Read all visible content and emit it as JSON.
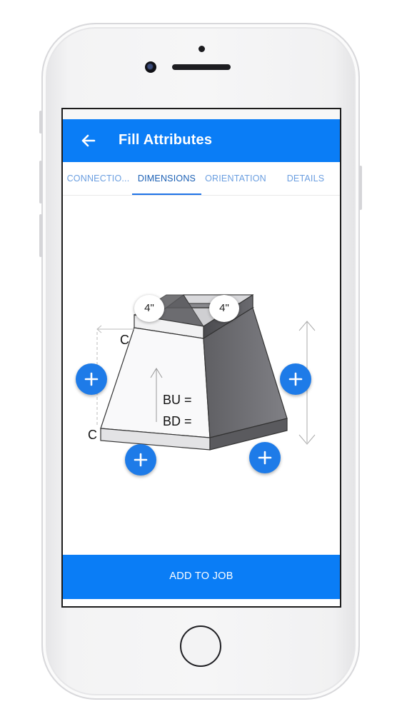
{
  "header": {
    "title": "Fill Attributes"
  },
  "tabs": [
    {
      "label": "CONNECTIO...",
      "active": false
    },
    {
      "label": "DIMENSIONS",
      "active": true
    },
    {
      "label": "ORIENTATION",
      "active": false
    },
    {
      "label": "DETAILS",
      "active": false
    }
  ],
  "diagram": {
    "top_left_dim": "4\"",
    "top_right_dim": "4\"",
    "connection_top_label": "C",
    "connection_bottom_label": "C",
    "bu_label": "BU =",
    "bd_label": "BD ="
  },
  "footer": {
    "add_button": "ADD TO JOB"
  },
  "colors": {
    "primary": "#0a7df6",
    "fab": "#1e7be8",
    "tab_text": "#6a9ee0",
    "tab_indicator": "#1e73e8"
  },
  "icons": [
    "back-arrow-icon",
    "plus-icon"
  ]
}
